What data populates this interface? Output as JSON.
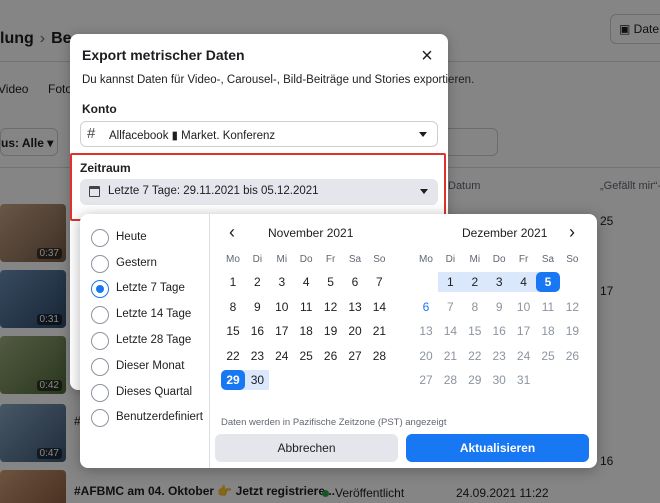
{
  "background": {
    "breadcrumb": {
      "part1": "lung",
      "part2": "Be"
    },
    "date_button": "Date",
    "tabs": [
      "Video",
      "Foto"
    ],
    "status_filter": "us: Alle",
    "columns": {
      "date": "Datum",
      "likes": "„Gefällt mir“-A"
    },
    "rows": [
      {
        "duration": "0:37",
        "count": "25"
      },
      {
        "duration": "0:31",
        "count": "17"
      },
      {
        "duration": "0:42",
        "count": ""
      },
      {
        "duration": "0:47",
        "count": "16"
      }
    ],
    "last_row": {
      "title": "#AFBMC am 04. Oktober 👉 Jetzt registriere...",
      "status": "Veröffentlicht",
      "date": "24.09.2021 11:22"
    },
    "side_marks": [
      "#"
    ]
  },
  "dialog": {
    "title": "Export metrischer Daten",
    "close_symbol": "×",
    "description": "Du kannst Daten für Video-, Carousel-, Bild-Beiträge und Stories exportieren.",
    "account_label": "Konto",
    "account_icon": "hash-icon",
    "account_value": "Allfacebook ▮ Market. Konferenz",
    "period_label": "Zeitraum",
    "period_value": "Letzte 7 Tage: 29.11.2021 bis 05.12.2021"
  },
  "calendar": {
    "presets": [
      {
        "label": "Heute",
        "selected": false
      },
      {
        "label": "Gestern",
        "selected": false
      },
      {
        "label": "Letzte 7 Tage",
        "selected": true
      },
      {
        "label": "Letzte 14 Tage",
        "selected": false
      },
      {
        "label": "Letzte 28 Tage",
        "selected": false
      },
      {
        "label": "Dieser Monat",
        "selected": false
      },
      {
        "label": "Dieses Quartal",
        "selected": false
      },
      {
        "label": "Benutzerdefiniert",
        "selected": false
      }
    ],
    "prev_symbol": "‹",
    "next_symbol": "›",
    "weekdays": [
      "Mo",
      "Di",
      "Mi",
      "Do",
      "Fr",
      "Sa",
      "So"
    ],
    "months": [
      {
        "title": "November 2021",
        "weeks": [
          [
            "1",
            "2",
            "3",
            "4",
            "5",
            "6",
            "7"
          ],
          [
            "8",
            "9",
            "10",
            "11",
            "12",
            "13",
            "14"
          ],
          [
            "15",
            "16",
            "17",
            "18",
            "19",
            "20",
            "21"
          ],
          [
            "22",
            "23",
            "24",
            "25",
            "26",
            "27",
            "28"
          ],
          [
            "29",
            "30",
            "",
            "",
            "",
            "",
            ""
          ]
        ]
      },
      {
        "title": "Dezember 2021",
        "weeks": [
          [
            "",
            "1",
            "2",
            "3",
            "4",
            "5",
            ""
          ],
          [
            "6",
            "7",
            "8",
            "9",
            "10",
            "11",
            "12"
          ],
          [
            "13",
            "14",
            "15",
            "16",
            "17",
            "18",
            "19"
          ],
          [
            "20",
            "21",
            "22",
            "23",
            "24",
            "25",
            "26"
          ],
          [
            "27",
            "28",
            "29",
            "30",
            "31",
            "",
            ""
          ]
        ]
      }
    ],
    "timezone_note": "Daten werden in Pazifische Zeitzone (PST) angezeigt",
    "cancel_label": "Abbrechen",
    "apply_label": "Aktualisieren",
    "accent_color": "#1877f2",
    "range_color": "#dbe7fb",
    "highlight_border_color": "#e0322a"
  }
}
